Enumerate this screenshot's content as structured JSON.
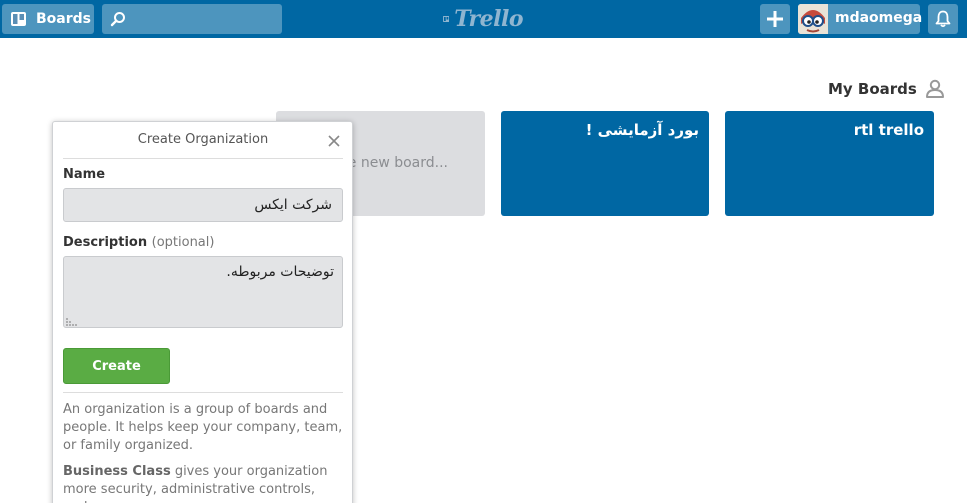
{
  "header": {
    "boards_label": "Boards",
    "search_value": "",
    "logo_text": "Trello",
    "username": "mdaomega",
    "brand_color": "#0067a3"
  },
  "main": {
    "my_boards_title": "My Boards",
    "new_board_label": "Create new board...",
    "boards": [
      {
        "name": "بورد آزمایشی !",
        "color": "#0067a3"
      },
      {
        "name": "rtl trello",
        "color": "#0067a3"
      }
    ]
  },
  "create_org": {
    "title": "Create Organization",
    "name_label": "Name",
    "name_value": "شرکت ایکس",
    "description_label": "Description",
    "description_optional": "(optional)",
    "description_value": "توضیحات مربوطه.",
    "create_button": "Create",
    "info_1": "An organization is a group of boards and people. It helps keep your company, team, or family organized.",
    "info_2_strong": "Business Class",
    "info_2_rest": " gives your organization more security, administrative controls, and",
    "accent_color": "#5aac44"
  }
}
